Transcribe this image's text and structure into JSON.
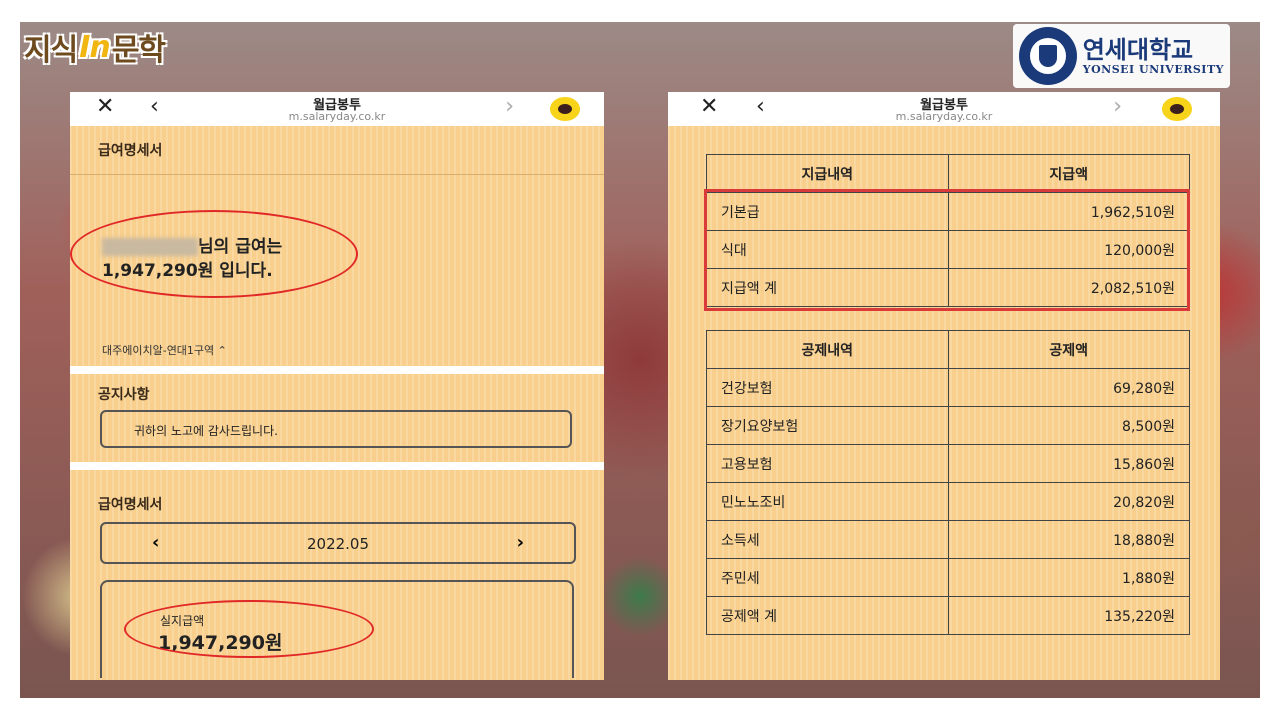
{
  "brand": {
    "logo_part1": "지식",
    "logo_in": "In",
    "logo_part2": "문학"
  },
  "university": {
    "name_ko": "연세대학교",
    "name_en": "YONSEI UNIVERSITY"
  },
  "browser": {
    "title": "월급봉투",
    "url": "m.salaryday.co.kr"
  },
  "left_panel": {
    "section1_title": "급여명세서",
    "salary_message_suffix": "님의 급여는",
    "salary_message_line2": "1,947,290원 입니다.",
    "company": "대주에이치알-연대1구역 ⌃",
    "notice_title": "공지사항",
    "notice_text": "귀하의 노고에 감사드립니다.",
    "section2_title": "급여명세서",
    "month": "2022.05",
    "net_label": "실지급액",
    "net_amount": "1,947,290원"
  },
  "payments": {
    "header_item": "지급내역",
    "header_amount": "지급액",
    "rows": [
      {
        "item": "기본급",
        "amount": "1,962,510원"
      },
      {
        "item": "식대",
        "amount": "120,000원"
      },
      {
        "item": "지급액 계",
        "amount": "2,082,510원"
      }
    ]
  },
  "deductions": {
    "header_item": "공제내역",
    "header_amount": "공제액",
    "rows": [
      {
        "item": "건강보험",
        "amount": "69,280원"
      },
      {
        "item": "장기요양보험",
        "amount": "8,500원"
      },
      {
        "item": "고용보험",
        "amount": "15,860원"
      },
      {
        "item": "민노노조비",
        "amount": "20,820원"
      },
      {
        "item": "소득세",
        "amount": "18,880원"
      },
      {
        "item": "주민세",
        "amount": "1,880원"
      },
      {
        "item": "공제액 계",
        "amount": "135,220원"
      }
    ]
  },
  "colors": {
    "accent_red": "#e02828",
    "panel_bg": "#f8cf8c",
    "kakao_yellow": "#f7d31a"
  },
  "icons": {
    "close": "close-icon",
    "back": "chevron-left-icon",
    "forward": "chevron-right-icon",
    "chat": "kakao-chat-icon"
  }
}
